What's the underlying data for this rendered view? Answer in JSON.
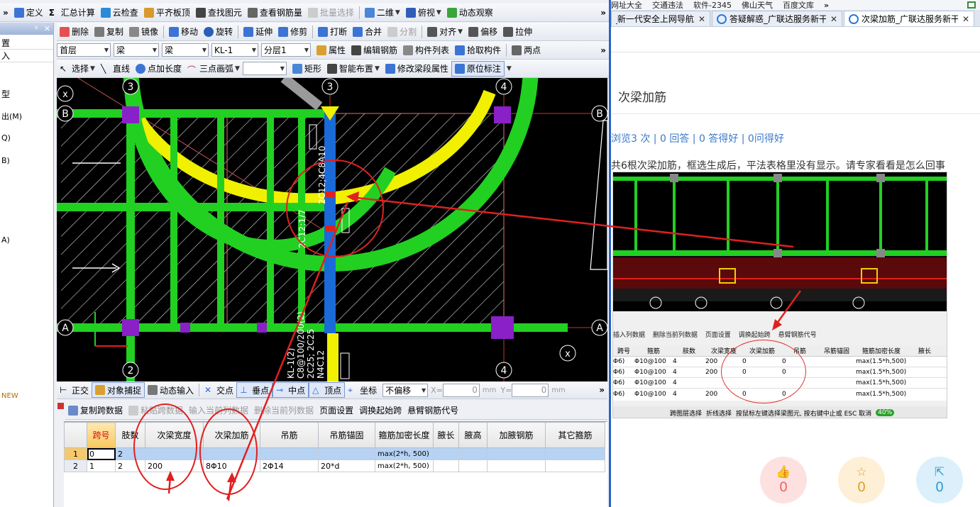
{
  "toolbar1": {
    "items": [
      "定义",
      "汇总计算",
      "云检查",
      "平齐板顶",
      "查找图元",
      "查看钢筋量",
      "批量选择",
      "二维",
      "俯视",
      "动态观察"
    ]
  },
  "toolbar2": {
    "items": [
      "删除",
      "复制",
      "镜像",
      "移动",
      "旋转",
      "延伸",
      "修剪",
      "打断",
      "合并",
      "分割",
      "对齐",
      "偏移",
      "拉伸"
    ]
  },
  "toolbar3": {
    "floor": "首层",
    "type1": "梁",
    "type2": "梁",
    "member": "KL-1",
    "layer": "分层1",
    "items": [
      "属性",
      "编辑钢筋",
      "构件列表",
      "拾取构件",
      "两点"
    ]
  },
  "toolbar4": {
    "items": [
      "选择",
      "直线",
      "点加长度",
      "三点画弧",
      "矩形",
      "智能布置",
      "修改梁段属性",
      "原位标注"
    ]
  },
  "side_panel": {
    "rows": [
      "置",
      "入"
    ],
    "list": [
      "型",
      "出(M)",
      "Q)",
      "B)",
      "A)",
      "NEW"
    ]
  },
  "canvas": {
    "axis_labels": [
      "3",
      "4",
      "3",
      "4",
      "B",
      "B",
      "A",
      "A",
      "2",
      "x",
      "x"
    ],
    "beam_text": [
      "KL-1(2)",
      "C8@100/200(2)",
      "2C25; 2C25",
      "N4C12",
      "2C12;1/7",
      "2C12;4C8A10"
    ]
  },
  "snap_bar": {
    "items": [
      "正交",
      "对象捕捉",
      "动态输入",
      "交点",
      "垂点",
      "中点",
      "顶点",
      "坐标",
      "不偏移"
    ],
    "x_label": "X=",
    "x_value": "0",
    "y_label": "Y=",
    "y_value": "0",
    "unit": "mm"
  },
  "grid_toolbar": {
    "items": [
      "复制跨数据",
      "粘贴跨数据",
      "输入当前列数据",
      "删除当前列数据",
      "页面设置",
      "调换起始跨",
      "悬臂钢筋代号"
    ]
  },
  "table": {
    "headers": [
      "跨号",
      "肢数",
      "次梁宽度",
      "次梁加筋",
      "吊筋",
      "吊筋锚固",
      "箍筋加密长度",
      "腋长",
      "腋高",
      "加腋钢筋",
      "其它箍筋"
    ],
    "rows": [
      [
        "1",
        "0",
        "2",
        "",
        "",
        "",
        "",
        "max(2*h, 500)",
        "",
        "",
        "",
        ""
      ],
      [
        "2",
        "1",
        "2",
        "200",
        "8Φ10",
        "2Φ14",
        "20*d",
        "max(2*h, 500)",
        "",
        "",
        "",
        ""
      ]
    ]
  },
  "browser": {
    "bookmarks": [
      "网址大全",
      "交通违法",
      "软件-2345",
      "佛山天气",
      "百度文库"
    ],
    "tabs": [
      "导航_新一代安全上网导航",
      "答疑解惑_广联达服务新干线",
      "次梁加筋_广联达服务新干线"
    ],
    "question_title": "次梁加筋",
    "stats": "浏览3 次 | 0 回答 | 0 答得好 | 0问得好",
    "question_text": "共6根次梁加筋，框选生成后，平法表格里没有显示。请专家看看是怎么回事",
    "embedded": {
      "toolbar": [
        "插入列数据",
        "删除当前列数据",
        "页面设置",
        "调换起始跨",
        "悬臂钢筋代号"
      ],
      "headers": [
        "跨号",
        "箍筋",
        "肢数",
        "次梁宽度",
        "次梁加筋",
        "吊筋",
        "吊筋锚固",
        "箍筋加密长度",
        "腋长"
      ],
      "rows": [
        [
          "Φ6)",
          "Φ10@100",
          "4",
          "200",
          "0",
          "0",
          "",
          "max(1.5*h,500)"
        ],
        [
          "Φ6)",
          "Φ10@100",
          "4",
          "200",
          "0",
          "0",
          "",
          "max(1.5*h,500)"
        ],
        [
          "Φ6)",
          "Φ10@100",
          "4",
          "",
          "",
          "",
          "",
          "max(1.5*h,500)"
        ],
        [
          "Φ6)",
          "Φ10@100",
          "4",
          "200",
          "0",
          "0",
          "",
          "max(1.5*h,500)"
        ]
      ],
      "status": "按鼠标左键选择梁图元, 按右键中止或 ESC 取消",
      "status_items": [
        "跨图层选择",
        "折线选择"
      ],
      "zoom": "40%"
    },
    "likes": "0",
    "favorites": "0",
    "shares": "0"
  }
}
